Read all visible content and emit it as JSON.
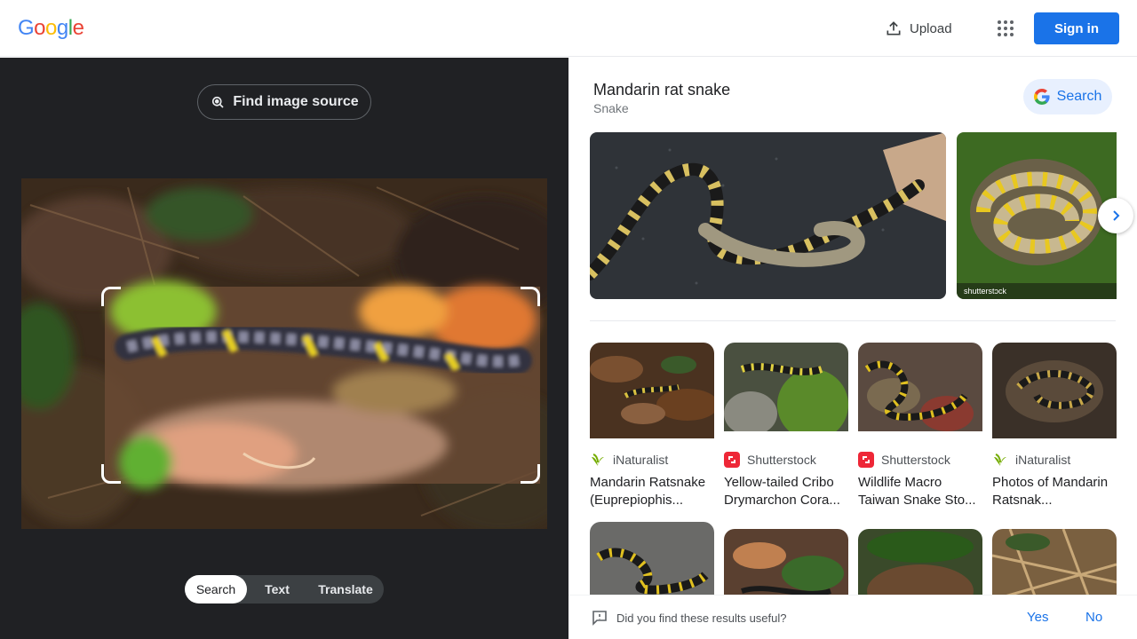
{
  "header": {
    "logo_letters": [
      "G",
      "o",
      "o",
      "g",
      "l",
      "e"
    ],
    "upload_label": "Upload",
    "apps_icon": "apps-grid-icon",
    "signin_label": "Sign in"
  },
  "colors": {
    "google_blue": "#4285F4",
    "google_red": "#EA4335",
    "google_yellow": "#FBBC05",
    "google_green": "#34A853",
    "accent": "#1a73e8",
    "dark_panel": "#202124"
  },
  "lens": {
    "find_source_label": "Find image source",
    "modes": [
      "Search",
      "Text",
      "Translate"
    ],
    "active_mode": "Search"
  },
  "knowledge": {
    "title": "Mandarin rat snake",
    "subtitle": "Snake",
    "search_label": "Search"
  },
  "results": [
    {
      "source": "iNaturalist",
      "title": "Mandarin Ratsnake (Euprepiophis...",
      "icon": "inaturalist-icon"
    },
    {
      "source": "Shutterstock",
      "title": "Yellow-tailed Cribo Drymarchon Cora...",
      "icon": "shutterstock-icon"
    },
    {
      "source": "Shutterstock",
      "title": "Wildlife Macro Taiwan Snake Sto...",
      "icon": "shutterstock-icon"
    },
    {
      "source": "iNaturalist",
      "title": "Photos of Mandarin Ratsnak...",
      "icon": "inaturalist-icon"
    }
  ],
  "watermark": "shutterstɔck",
  "feedback": {
    "question": "Did you find these results useful?",
    "yes": "Yes",
    "no": "No"
  }
}
